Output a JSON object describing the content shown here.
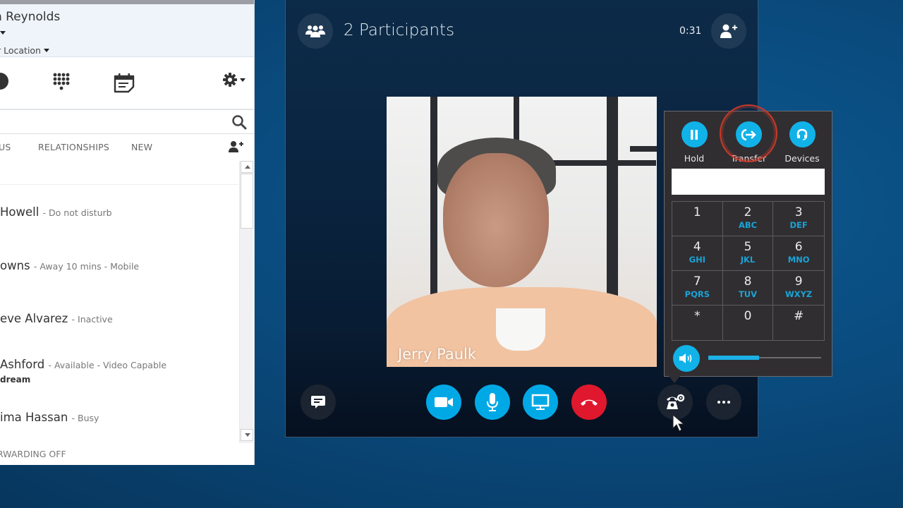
{
  "contacts_window": {
    "user_name": "n Reynolds",
    "location_label": "r Location",
    "search": {
      "placeholder": "",
      "value": ""
    },
    "tabs": [
      {
        "label": "US"
      },
      {
        "label": "RELATIONSHIPS"
      },
      {
        "label": "NEW"
      }
    ],
    "contacts": [
      {
        "name": "Howell",
        "status": "- Do not disturb",
        "note": ""
      },
      {
        "name": "owns",
        "status": "- Away 10 mins - Mobile",
        "note": ""
      },
      {
        "name": "eve Alvarez",
        "status": "- Inactive",
        "note": ""
      },
      {
        "name": "Ashford",
        "status": "- Available - Video Capable",
        "note": "dream"
      },
      {
        "name": "ima Hassan",
        "status": "- Busy",
        "note": ""
      }
    ],
    "forwarding_status": "RWARDING OFF"
  },
  "call_window": {
    "participants_label": "2 Participants",
    "duration": "0:31",
    "caller_name": "Jerry Paulk",
    "call_controls": {
      "hold_label": "Hold",
      "transfer_label": "Transfer",
      "devices_label": "Devices",
      "dial_input_value": "",
      "keypad": [
        {
          "digit": "1",
          "letters": ""
        },
        {
          "digit": "2",
          "letters": "ABC"
        },
        {
          "digit": "3",
          "letters": "DEF"
        },
        {
          "digit": "4",
          "letters": "GHI"
        },
        {
          "digit": "5",
          "letters": "JKL"
        },
        {
          "digit": "6",
          "letters": "MNO"
        },
        {
          "digit": "7",
          "letters": "PQRS"
        },
        {
          "digit": "8",
          "letters": "TUV"
        },
        {
          "digit": "9",
          "letters": "WXYZ"
        },
        {
          "digit": "*",
          "letters": ""
        },
        {
          "digit": "0",
          "letters": ""
        },
        {
          "digit": "#",
          "letters": ""
        }
      ],
      "volume_level_percent": 45
    }
  },
  "colors": {
    "accent_blue": "#00a9e6",
    "hangup_red": "#e0182d",
    "highlight_ring": "#c53a2b",
    "keypad_letters": "#1aa3d6"
  }
}
